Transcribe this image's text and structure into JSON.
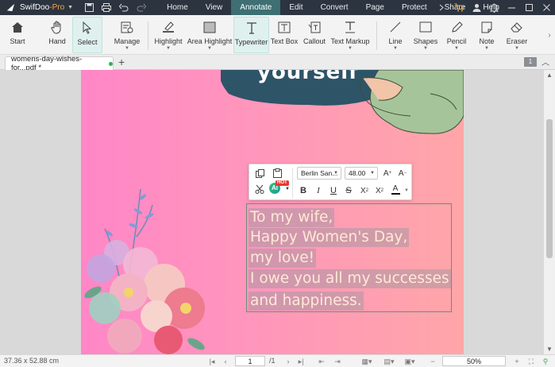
{
  "app": {
    "name": "SwifDoo",
    "edition": "-Pro"
  },
  "menu": [
    "Home",
    "View",
    "Annotate",
    "Edit",
    "Convert",
    "Page",
    "Protect",
    "Share",
    "Help"
  ],
  "menu_active": "Annotate",
  "ribbon": {
    "start": "Start",
    "hand": "Hand",
    "select": "Select",
    "manage": "Manage",
    "highlight": "Highlight",
    "area_highlight": "Area Highlight",
    "typewriter": "Typewriter",
    "text_box": "Text Box",
    "callout": "Callout",
    "text_markup": "Text Markup",
    "line": "Line",
    "shapes": "Shapes",
    "pencil": "Pencil",
    "note": "Note",
    "eraser": "Eraser"
  },
  "tab": {
    "filename": "womens-day-wishes-for...pdf *",
    "page_badge": "1"
  },
  "page_content": {
    "headline_fragment": "yourself"
  },
  "text_toolbar": {
    "font": "Berlin San...",
    "size": "48.00",
    "hot_badge": "HOT",
    "ai_label": "AI"
  },
  "textbox_lines": [
    "To my wife,",
    "Happy Women's Day,",
    "my love!",
    "I owe you all my successes",
    "and happiness."
  ],
  "status": {
    "dimensions": "37.36 x 52.88 cm",
    "current_page": "1",
    "total_pages": "/1",
    "zoom": "50%"
  },
  "colors": {
    "accent": "#3d6f73",
    "page_left": "#ff86c7",
    "page_right": "#ffa6a8"
  }
}
